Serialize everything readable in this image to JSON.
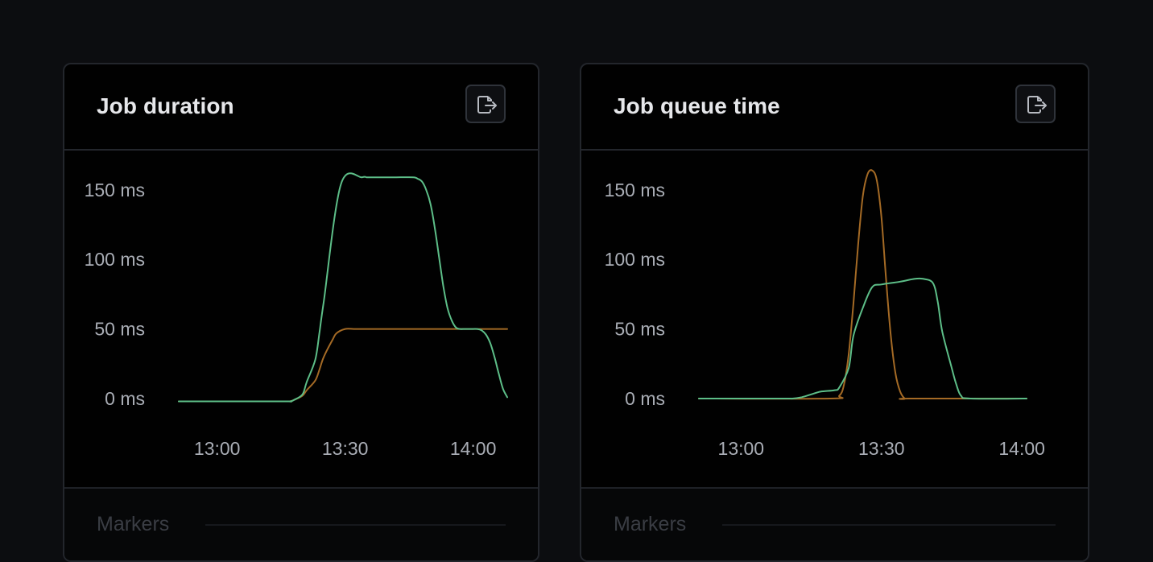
{
  "colors": {
    "page_bg": "#0c0d10",
    "card_bg": "#010101",
    "series_green": "#5dbe88",
    "series_orange": "#a46a25",
    "axis_text": "#a9adb5"
  },
  "icons": {
    "export": "export-icon"
  },
  "cards": [
    {
      "title": "Job duration",
      "markers_label": "Markers"
    },
    {
      "title": "Job queue time",
      "markers_label": "Markers"
    }
  ],
  "chart_data": [
    {
      "type": "line",
      "title": "Job duration",
      "xlabel": "",
      "ylabel": "",
      "x_tick_labels": [
        "13:00",
        "13:30",
        "14:00"
      ],
      "y_tick_labels": [
        "0 ms",
        "50 ms",
        "100 ms",
        "150 ms"
      ],
      "y_ticks": [
        0,
        50,
        100,
        150
      ],
      "x_ticks": [
        780,
        810,
        840
      ],
      "xlim": [
        771,
        848
      ],
      "ylim": [
        0,
        165
      ],
      "grid": false,
      "legend": "none",
      "series": [
        {
          "color": "#5dbe88",
          "x": [
            771,
            795,
            797,
            798,
            800,
            801,
            803,
            804,
            805,
            809,
            814,
            815,
            816,
            817,
            818,
            819,
            820,
            821,
            822,
            826,
            827,
            828,
            829,
            830,
            831,
            832,
            833,
            834,
            835,
            836,
            837,
            838,
            839,
            840,
            841,
            842,
            843,
            844,
            845,
            846,
            847,
            848
          ],
          "y": [
            -2,
            -2,
            -2,
            -1,
            3,
            12,
            28,
            48,
            70,
            154,
            159,
            159,
            159,
            159,
            159,
            159,
            159,
            159,
            159,
            159,
            158,
            156,
            150,
            140,
            123,
            102,
            81,
            65,
            56,
            51,
            50,
            50,
            50,
            50,
            50,
            49,
            46,
            40,
            30,
            18,
            7,
            1
          ]
        },
        {
          "color": "#a46a25",
          "x": [
            771,
            795,
            797,
            798,
            800,
            801,
            803,
            804,
            805,
            807,
            808,
            810,
            812,
            814,
            816,
            818,
            820,
            825,
            830,
            835,
            840,
            845,
            848
          ],
          "y": [
            -2,
            -2,
            -2,
            -1,
            2,
            6,
            13,
            21,
            30,
            42,
            47,
            50,
            50,
            50,
            50,
            50,
            50,
            50,
            50,
            50,
            50,
            50,
            50
          ]
        }
      ]
    },
    {
      "type": "line",
      "title": "Job queue time",
      "xlabel": "",
      "ylabel": "",
      "x_tick_labels": [
        "13:00",
        "13:30",
        "14:00"
      ],
      "y_tick_labels": [
        "0 ms",
        "50 ms",
        "100 ms",
        "150 ms"
      ],
      "y_ticks": [
        0,
        50,
        100,
        150
      ],
      "x_ticks": [
        780,
        810,
        840
      ],
      "xlim": [
        771,
        841
      ],
      "ylim": [
        0,
        165
      ],
      "grid": false,
      "legend": "none",
      "series": [
        {
          "color": "#5dbe88",
          "x": [
            771,
            789,
            791,
            793,
            795,
            797,
            800,
            801,
            803,
            804,
            806,
            808,
            810,
            814,
            817,
            819,
            821,
            822,
            823,
            825,
            826,
            827,
            829,
            841
          ],
          "y": [
            0,
            0,
            0,
            1,
            3,
            5,
            6,
            8,
            22,
            45,
            65,
            80,
            82,
            84,
            86,
            86,
            83,
            70,
            48,
            22,
            10,
            2,
            0,
            0
          ]
        },
        {
          "color": "#a46a25",
          "x": [
            771,
            799,
            801,
            802,
            803,
            804,
            805,
            806,
            807,
            808,
            809,
            810,
            811,
            812,
            813,
            814,
            815,
            816,
            841
          ],
          "y": [
            0,
            0,
            2,
            10,
            32,
            68,
            110,
            145,
            161,
            164,
            157,
            130,
            85,
            45,
            18,
            5,
            0,
            0,
            0
          ]
        }
      ]
    }
  ]
}
